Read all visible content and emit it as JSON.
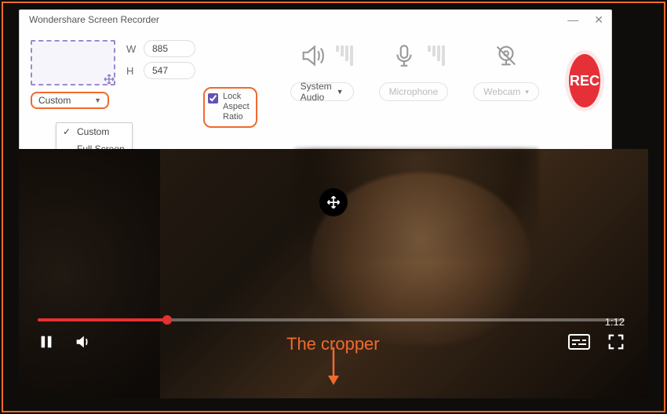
{
  "window": {
    "title": "Wondershare Screen Recorder"
  },
  "region": {
    "width": "885",
    "height": "547",
    "w_label": "W",
    "h_label": "H",
    "mode_selected": "Custom",
    "mode_options": [
      "Custom",
      "Full Screen"
    ],
    "lock_label": "Lock Aspect Ratio",
    "lock_checked": true
  },
  "sources": {
    "audio": {
      "label": "System Audio"
    },
    "mic": {
      "placeholder": "Microphone"
    },
    "cam": {
      "placeholder": "Webcam"
    }
  },
  "rec": {
    "label": "REC"
  },
  "player": {
    "duration": "1:12"
  },
  "annotation": {
    "text": "The cropper"
  }
}
